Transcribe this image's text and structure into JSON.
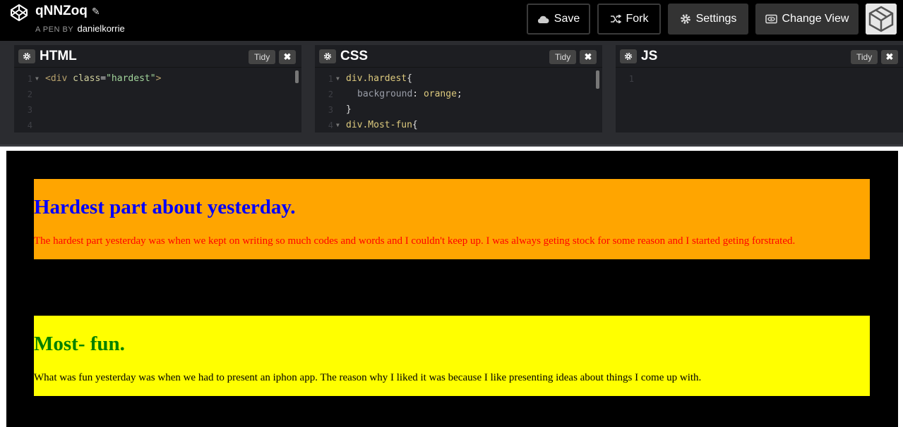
{
  "header": {
    "pen_title": "qNNZoq",
    "pen_by_label": "A PEN BY",
    "author": "danielkorrie",
    "buttons": {
      "save": "Save",
      "fork": "Fork",
      "settings": "Settings",
      "change_view": "Change View"
    }
  },
  "editors": {
    "html": {
      "title": "HTML",
      "tidy": "Tidy",
      "line_numbers": [
        "1",
        "2",
        "3",
        "4"
      ],
      "lines": [
        {
          "open": "<div ",
          "attr": "class",
          "eq": "=",
          "str": "\"hardest\"",
          "close": ">"
        }
      ]
    },
    "css": {
      "title": "CSS",
      "tidy": "Tidy",
      "line_numbers": [
        "1",
        "2",
        "3",
        "4"
      ],
      "lines": {
        "l1_sel": "div.hardest",
        "l1_brace": "{",
        "l2_prop": "background",
        "l2_colon": ": ",
        "l2_val": "orange",
        "l2_semi": ";",
        "l3": "}",
        "l4_sel": "div.Most-fun",
        "l4_brace": "{"
      }
    },
    "js": {
      "title": "JS",
      "tidy": "Tidy",
      "line_numbers": [
        "1"
      ]
    }
  },
  "preview": {
    "hardest": {
      "heading": "Hardest part about yesterday.",
      "text": "The hardest part yesterday was when we kept on writing so much codes and words and I couldn't keep up. I was always geting stock for some reason and I started geting forstrated."
    },
    "most_fun": {
      "heading": "Most- fun.",
      "text": "What was fun yesterday was when we had to present an iphon app. The reason why I liked it was because I like presenting ideas about things I come up with."
    },
    "colors": {
      "hardest_bg": "#ffa500",
      "hardest_heading": "#0000ff",
      "hardest_text": "#ff0000",
      "most_fun_bg": "#ffff00",
      "most_fun_heading": "#008000",
      "most_fun_text": "#000000"
    }
  },
  "icons": [
    "codepen-logo-icon",
    "pencil-icon",
    "cloud-icon",
    "fork-icon",
    "gear-icon",
    "eye-icon",
    "close-icon"
  ]
}
